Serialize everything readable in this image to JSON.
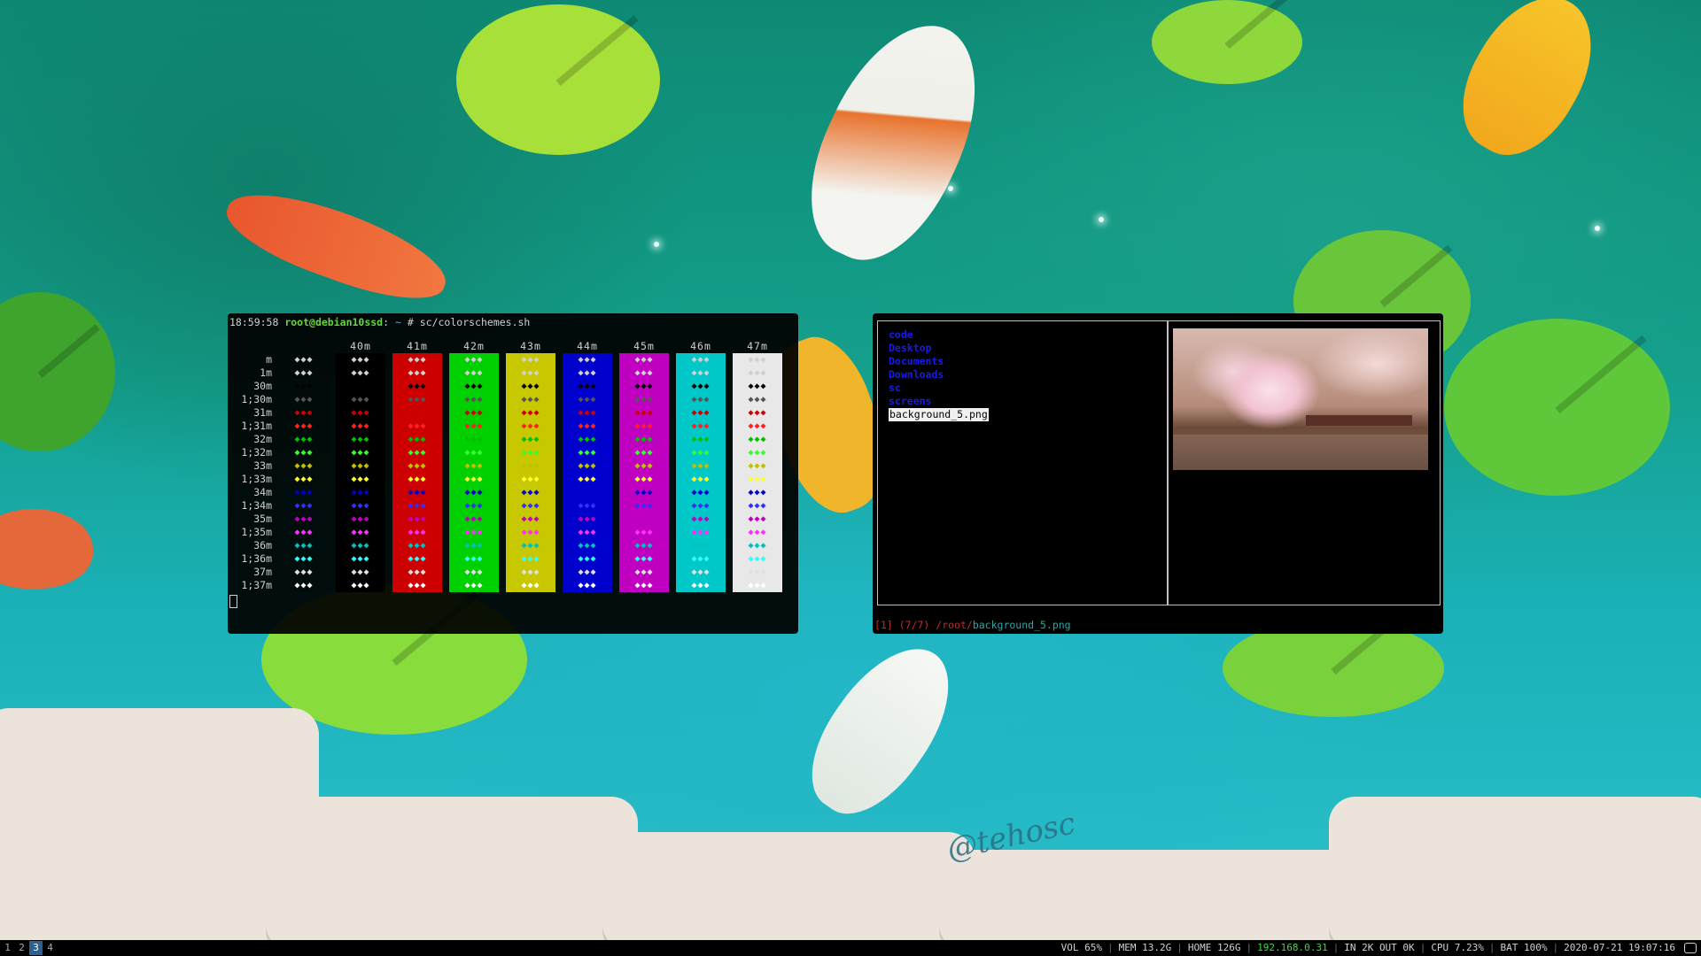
{
  "wallpaper": {
    "signature": "@tehosc"
  },
  "terminal": {
    "prompt": {
      "time": "18:59:58",
      "userhost": "root@debian10ssd",
      "path": "~",
      "symbol": "#",
      "command": "sc/colorschemes.sh"
    },
    "columns": [
      "",
      "40m",
      "41m",
      "42m",
      "43m",
      "44m",
      "45m",
      "46m",
      "47m"
    ],
    "rows": [
      "m",
      "1m",
      "30m",
      "1;30m",
      "31m",
      "1;31m",
      "32m",
      "1;32m",
      "33m",
      "1;33m",
      "34m",
      "1;34m",
      "35m",
      "1;35m",
      "36m",
      "1;36m",
      "37m",
      "1;37m"
    ],
    "glyph": "◆◆◆",
    "backgrounds": [
      "transparent",
      "#000000",
      "#cc0000",
      "#00d000",
      "#c8c800",
      "#0000cc",
      "#c000c0",
      "#00c8c8",
      "#e8e8e8"
    ],
    "foregrounds": {
      "m": "#d0d0d0",
      "1m": "#d0d0d0",
      "30m": "#000000",
      "1;30m": "#555555",
      "31m": "#cc0000",
      "1;31m": "#ff2020",
      "32m": "#00c000",
      "1;32m": "#30ff30",
      "33m": "#c0c000",
      "1;33m": "#ffff30",
      "34m": "#0000cc",
      "1;34m": "#3030ff",
      "35m": "#c000c0",
      "1;35m": "#ff30ff",
      "36m": "#00c0c0",
      "1;36m": "#30ffff",
      "37m": "#e0e0e0",
      "1;37m": "#ffffff"
    }
  },
  "file_manager": {
    "items": [
      "code",
      "Desktop",
      "Documents",
      "Downloads",
      "sc",
      "screens",
      "background_5.png"
    ],
    "selected_index": 6,
    "status": {
      "tab": "[1]",
      "position": "(7/7)",
      "dir": "/root/",
      "file": "background_5.png"
    }
  },
  "statusbar": {
    "workspaces": [
      "1",
      "2",
      "3",
      "4"
    ],
    "active_workspace": "3",
    "vol": "VOL 65%",
    "mem": "MEM 13.2G",
    "home": "HOME 126G",
    "ip": "192.168.0.31",
    "net": "IN 2K OUT 0K",
    "cpu": "CPU 7.23%",
    "bat": "BAT 100%",
    "datetime": "2020-07-21 19:07:16"
  }
}
